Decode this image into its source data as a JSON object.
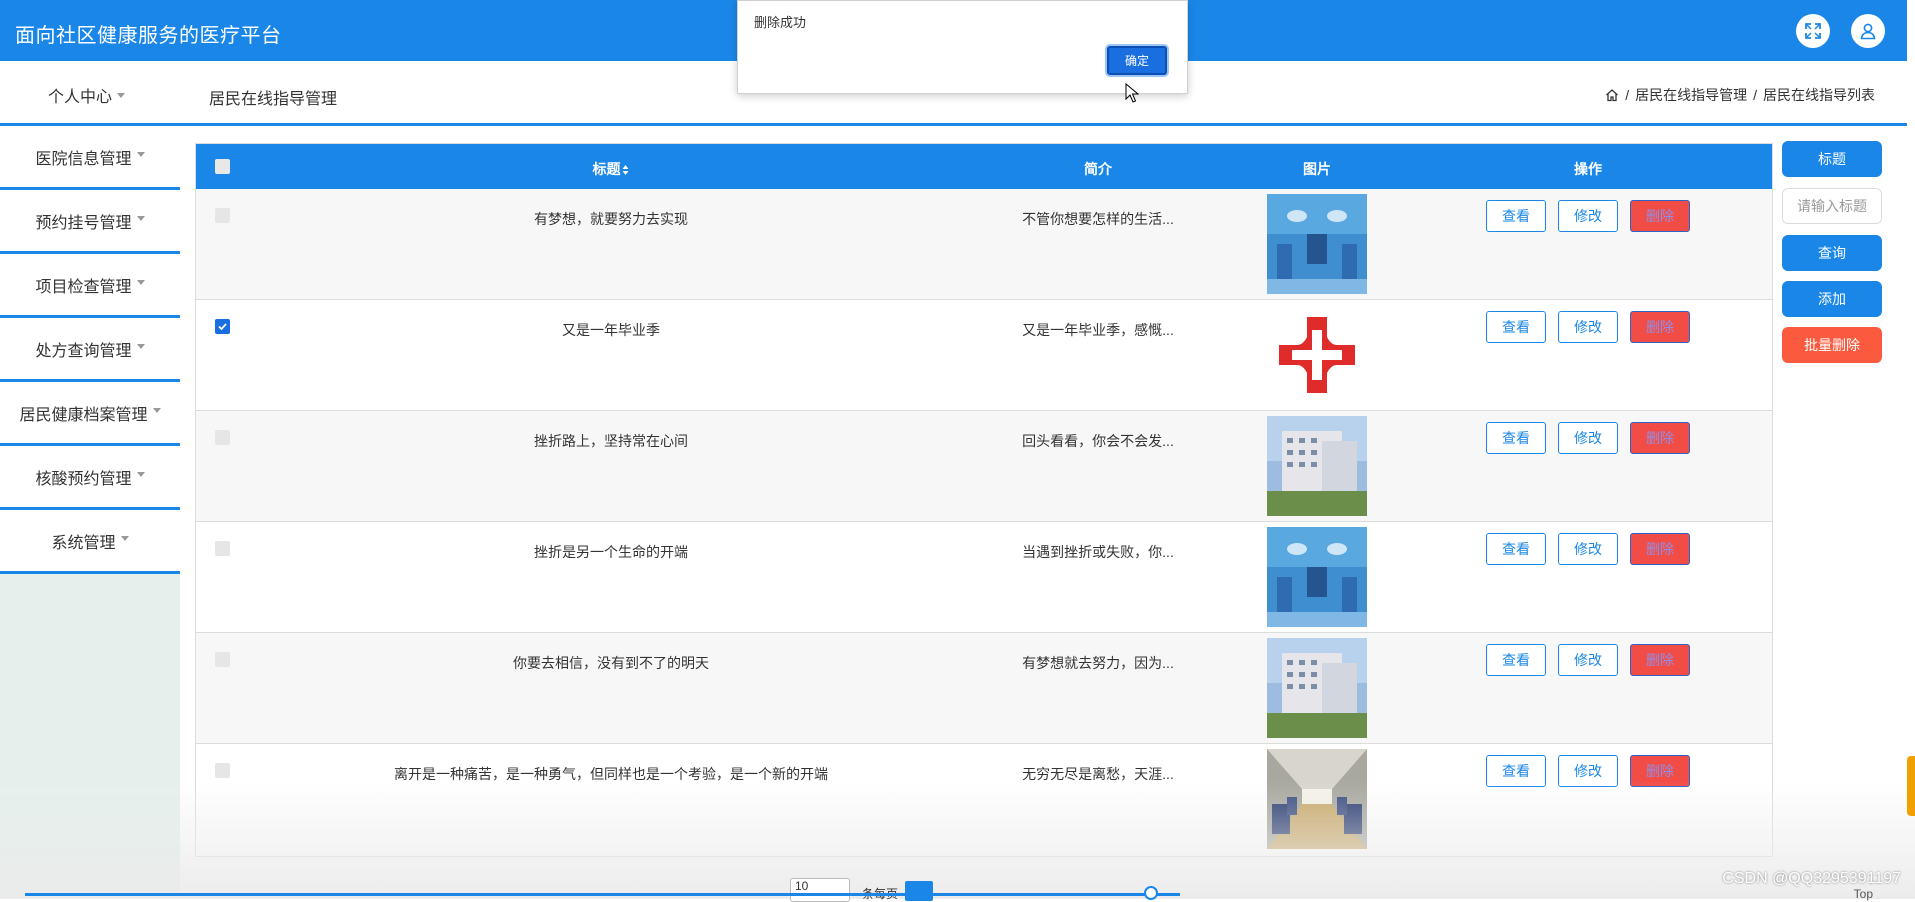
{
  "app": {
    "title": "面向社区健康服务的医疗平台",
    "icons": [
      "fullscreen-icon",
      "user-icon"
    ]
  },
  "header": {
    "personal_center": "个人中心",
    "page_title": "居民在线指导管理",
    "breadcrumb": [
      "居民在线指导管理",
      "居民在线指导列表"
    ],
    "breadcrumb_sep": "/"
  },
  "sidebar": {
    "items": [
      {
        "label": "医院信息管理"
      },
      {
        "label": "预约挂号管理"
      },
      {
        "label": "项目检查管理"
      },
      {
        "label": "处方查询管理"
      },
      {
        "label": "居民健康档案管理"
      },
      {
        "label": "核酸预约管理"
      },
      {
        "label": "系统管理"
      }
    ]
  },
  "table": {
    "columns": {
      "title": "标题",
      "title_sort_icon": "sort-icon",
      "intro": "简介",
      "image": "图片",
      "actions": "操作"
    },
    "actions": {
      "view": "查看",
      "edit": "修改",
      "delete": "删除"
    },
    "rows": [
      {
        "title": "有梦想，就要努力去实现",
        "intro": "不管你想要怎样的生活...",
        "image": "operating-room-photo",
        "checked": false
      },
      {
        "title": "又是一年毕业季",
        "intro": "又是一年毕业季，感慨...",
        "image": "red-cross-logo",
        "checked": true
      },
      {
        "title": "挫折路上，坚持常在心间",
        "intro": "回头看看，你会不会发...",
        "image": "hospital-building-photo",
        "checked": false
      },
      {
        "title": "挫折是另一个生命的开端",
        "intro": "当遇到挫折或失败，你...",
        "image": "operating-room-photo",
        "checked": false
      },
      {
        "title": "你要去相信，没有到不了的明天",
        "intro": "有梦想就去努力，因为...",
        "image": "hospital-building-photo",
        "checked": false
      },
      {
        "title": "离开是一种痛苦，是一种勇气，但同样也是一个考验，是一个新的开端",
        "intro": "无穷无尽是离愁，天涯...",
        "image": "ward-corridor-photo",
        "checked": false
      }
    ]
  },
  "right_panel": {
    "field_label": "标题",
    "search_placeholder": "请输入标题",
    "search_button": "查询",
    "add_button": "添加",
    "batch_delete_button": "批量删除"
  },
  "dialog": {
    "message": "删除成功",
    "ok_label": "确定"
  },
  "pager": {
    "page_size": "10",
    "label": "条每页"
  },
  "footer": {
    "watermark": "CSDN @QQ3295391197",
    "top_link": "Top"
  },
  "colors": {
    "primary": "#1a87e8",
    "delete": "#f24c47",
    "batch_delete": "#fc5a3f",
    "sidebar_bg": "#e5f0ec"
  }
}
